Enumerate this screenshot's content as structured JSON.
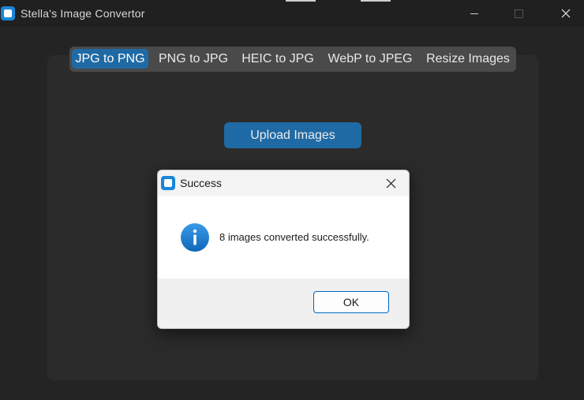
{
  "window": {
    "title": "Stella's Image Convertor"
  },
  "tabs": [
    {
      "label": "JPG to PNG",
      "active": true
    },
    {
      "label": "PNG to JPG",
      "active": false
    },
    {
      "label": "HEIC to JPG",
      "active": false
    },
    {
      "label": "WebP to JPEG",
      "active": false
    },
    {
      "label": "Resize Images",
      "active": false
    }
  ],
  "main": {
    "upload_label": "Upload Images"
  },
  "dialog": {
    "title": "Success",
    "message": "8 images converted successfully.",
    "ok_label": "OK",
    "icon": "info-icon"
  },
  "colors": {
    "accent": "#1f6aa5",
    "background": "#242424",
    "frame": "#2b2b2b",
    "tab_bar": "#4a4a4a",
    "info_blue": "#1a7fd4"
  }
}
